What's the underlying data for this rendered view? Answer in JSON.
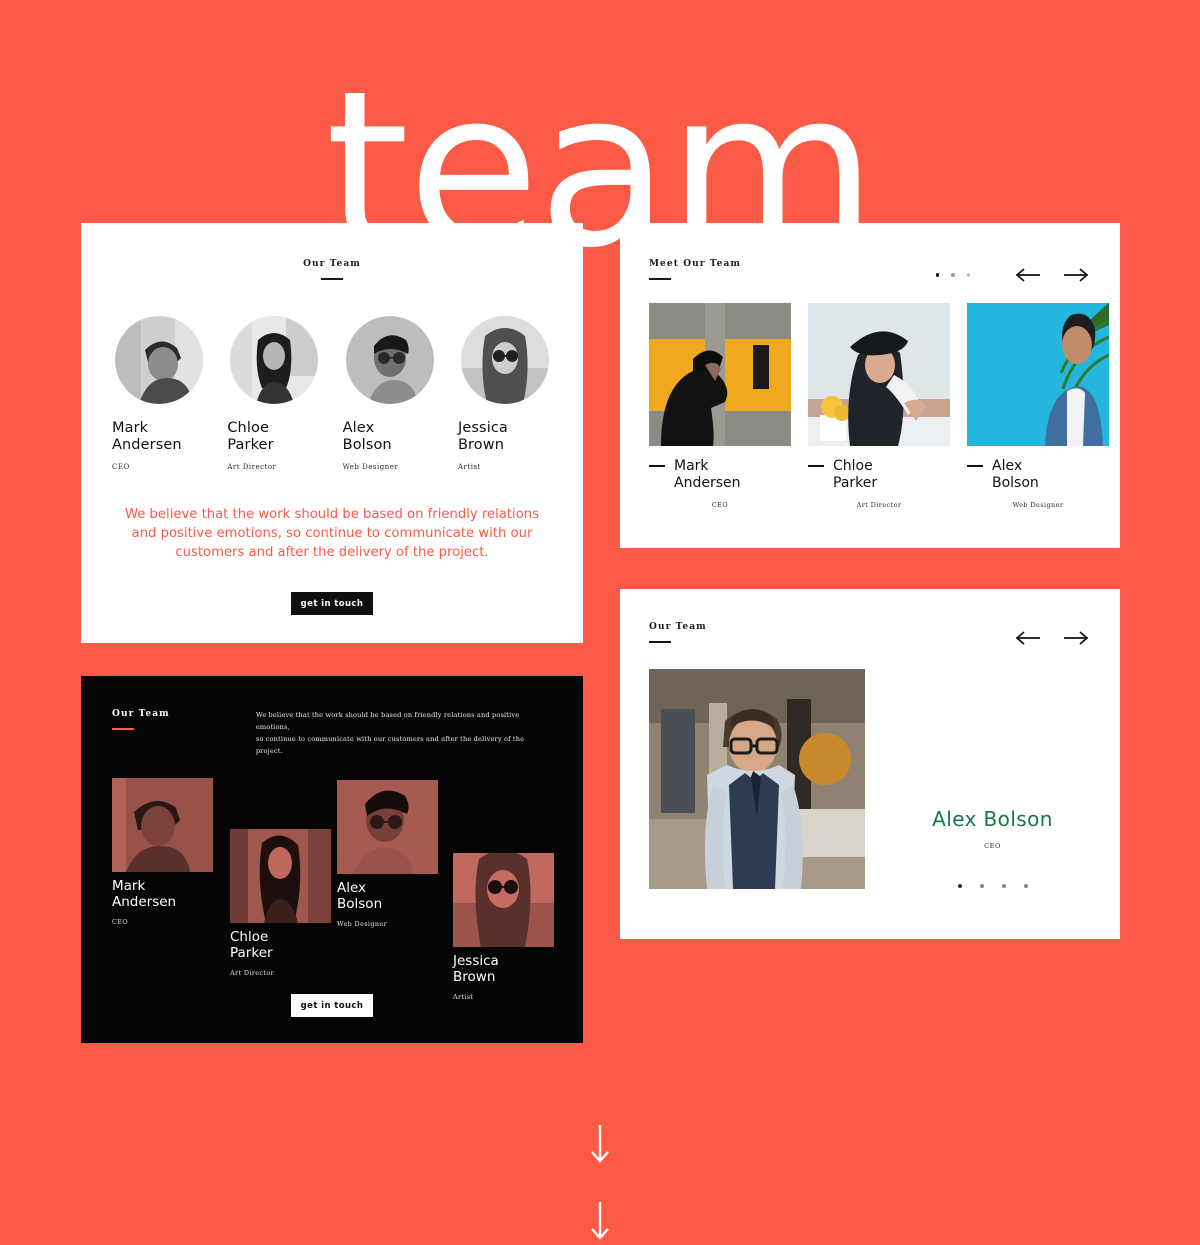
{
  "hero": {
    "title": "team"
  },
  "colors": {
    "background": "#fb5a46",
    "accent_coral": "#fb5a46",
    "dark": "#050505",
    "featured_green": "#187846",
    "white": "#ffffff"
  },
  "card_team_grid": {
    "eyebrow": "Our Team",
    "members": [
      {
        "name_line1": "Mark",
        "name_line2": "Andersen",
        "role": "CEO"
      },
      {
        "name_line1": "Chloe",
        "name_line2": "Parker",
        "role": "Art Director"
      },
      {
        "name_line1": "Alex",
        "name_line2": "Bolson",
        "role": "Web Designer"
      },
      {
        "name_line1": "Jessica",
        "name_line2": "Brown",
        "role": "Artist"
      }
    ],
    "quote": "We believe that the work should be based on friendly relations and positive emotions, so continue to communicate with our customers and after the delivery of the project.",
    "cta_label": "get in touch"
  },
  "card_meet_team": {
    "eyebrow": "Meet Our Team",
    "dots": [
      "active",
      "inactive",
      "inactive"
    ],
    "prev_label": "previous-slide",
    "next_label": "next-slide",
    "members": [
      {
        "name_line1": "Mark",
        "name_line2": "Andersen",
        "role": "CEO"
      },
      {
        "name_line1": "Chloe",
        "name_line2": "Parker",
        "role": "Art Director"
      },
      {
        "name_line1": "Alex",
        "name_line2": "Bolson",
        "role": "Web Designer"
      }
    ]
  },
  "card_dark": {
    "eyebrow": "Our Team",
    "copy_line1": "We believe that the work should be based on friendly relations and positive emotions,",
    "copy_line2": "so continue to communicate with our customers and after the delivery of the project.",
    "members": [
      {
        "name_line1": "Mark",
        "name_line2": "Andersen",
        "role": "CEO"
      },
      {
        "name_line1": "Chloe",
        "name_line2": "Parker",
        "role": "Art Director"
      },
      {
        "name_line1": "Alex",
        "name_line2": "Bolson",
        "role": "Web Designer"
      },
      {
        "name_line1": "Jessica",
        "name_line2": "Brown",
        "role": "Artist"
      }
    ],
    "cta_label": "get in touch"
  },
  "card_featured": {
    "eyebrow": "Our Team",
    "prev_label": "previous-slide",
    "next_label": "next-slide",
    "name": "Alex Bolson",
    "role": "CEO",
    "dots": [
      "active",
      "inactive",
      "inactive",
      "inactive"
    ]
  }
}
